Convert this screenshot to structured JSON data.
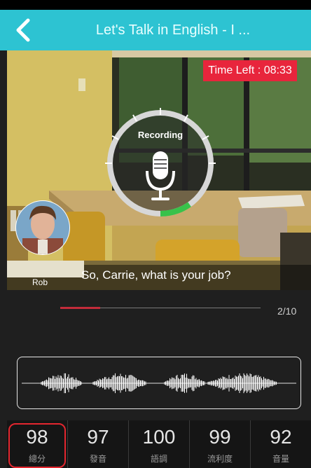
{
  "header": {
    "title": "Let's Talk in English - I ..."
  },
  "timer": {
    "label": "Time Left : 08:33"
  },
  "recording": {
    "label": "Recording",
    "level": 0.28
  },
  "dialogue": {
    "speaker": "Rob",
    "line": "So, Carrie, what is your job?"
  },
  "progress": {
    "count": "2/10",
    "fraction": 0.2
  },
  "scores": [
    {
      "value": "98",
      "label": "總分"
    },
    {
      "value": "97",
      "label": "發音"
    },
    {
      "value": "100",
      "label": "語調"
    },
    {
      "value": "99",
      "label": "流利度"
    },
    {
      "value": "92",
      "label": "音量"
    }
  ],
  "colors": {
    "header": "#2dc3d2",
    "timer_bg": "#e8253c",
    "recording_level": "#38c24a",
    "highlight": "#e3262f"
  }
}
